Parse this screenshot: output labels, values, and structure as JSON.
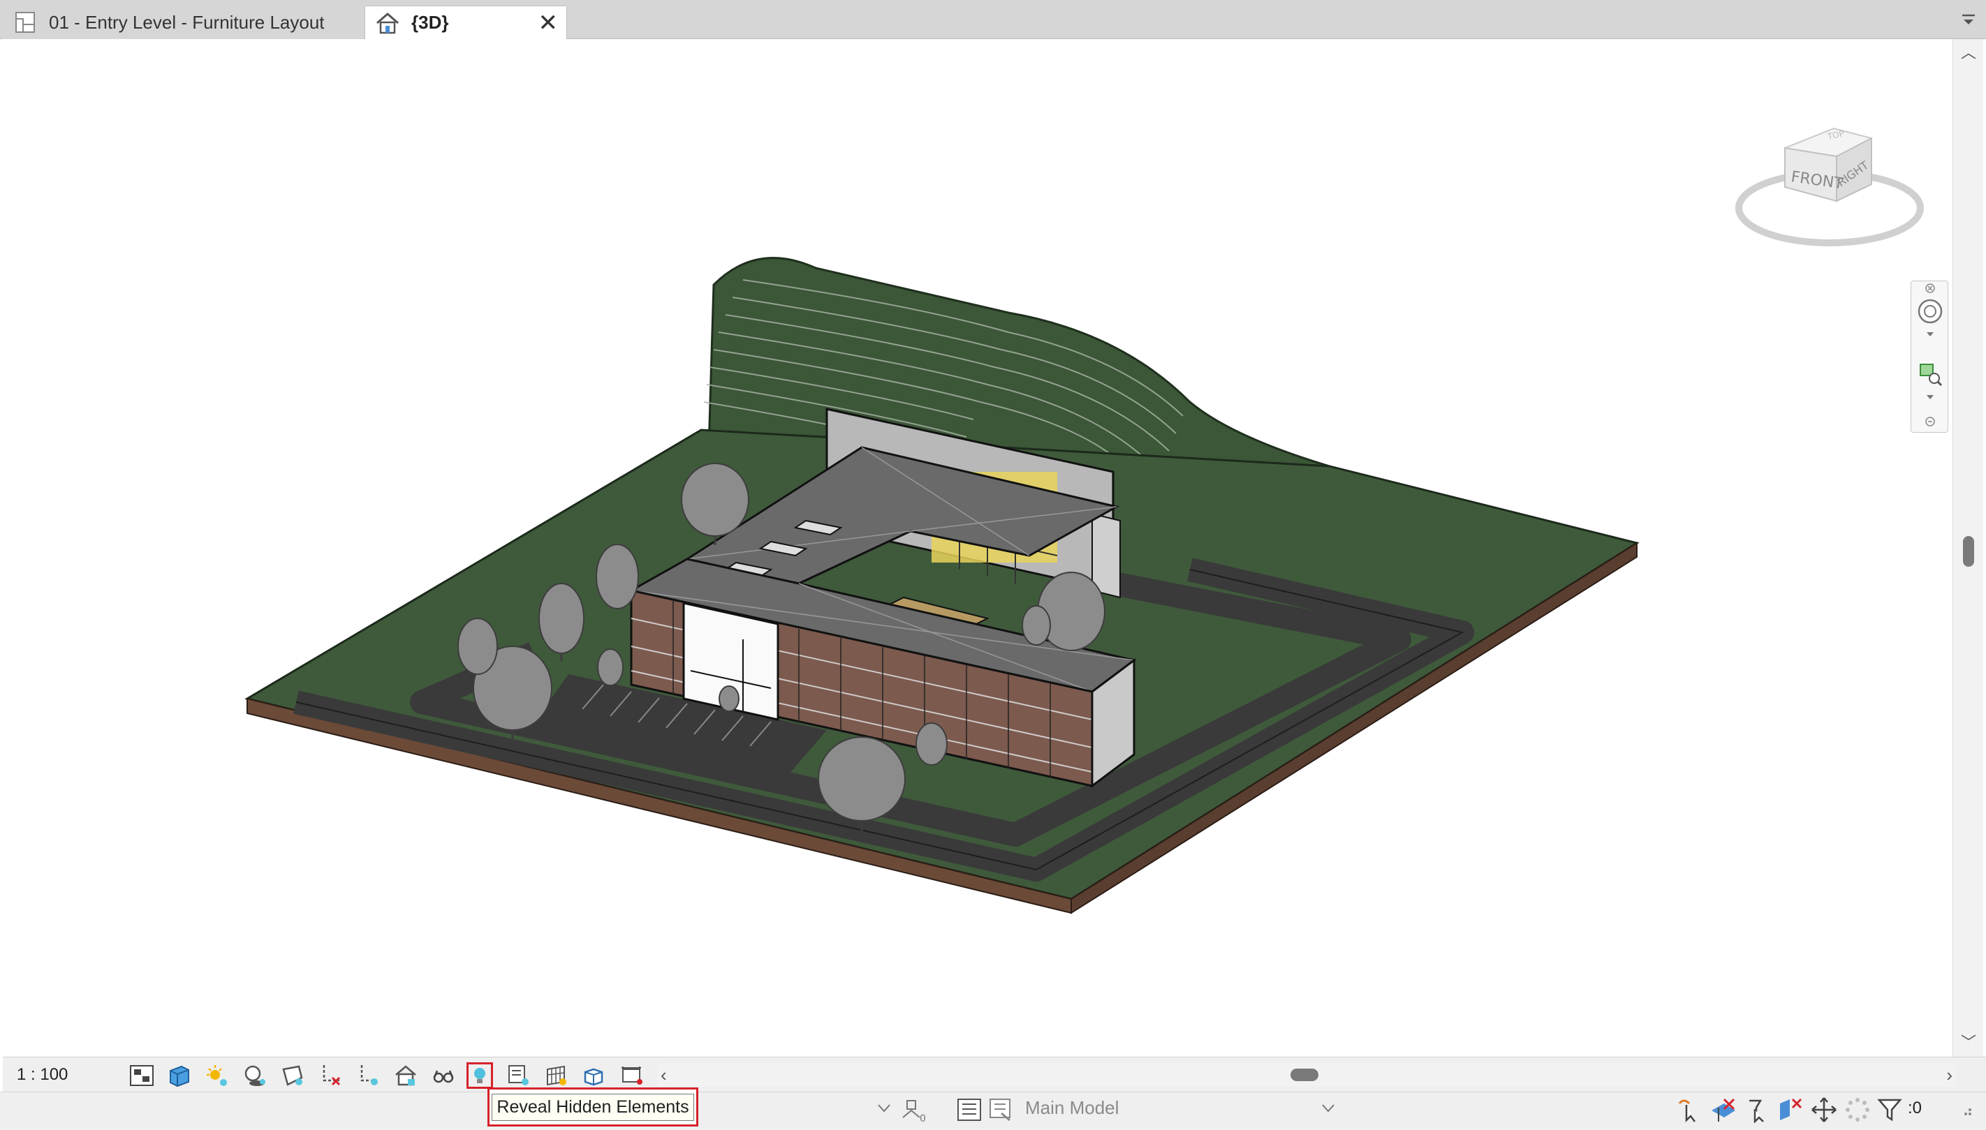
{
  "tabs": [
    {
      "label": "01 - Entry Level - Furniture Layout",
      "active": false
    },
    {
      "label": "{3D}",
      "active": true
    }
  ],
  "tab_close_symbol": "✕",
  "viewcube": {
    "top_label": "TOP",
    "front_label": "FRONT",
    "right_label": "RIGHT"
  },
  "view_control_bar": {
    "scale": "1 : 100",
    "icons": [
      "detail-level-icon",
      "visual-style-icon",
      "sun-path-icon",
      "shadows-icon",
      "rendering-icon",
      "crop-view-icon",
      "show-crop-region-icon",
      "unlock-3d-view-icon",
      "temporary-isolate-icon",
      "reveal-hidden-elements-icon",
      "temporary-view-properties-icon",
      "show-analytical-model-icon",
      "highlight-displacement-icon",
      "reveal-constraints-icon"
    ]
  },
  "tooltip": {
    "text": "Reveal Hidden Elements"
  },
  "status_bar": {
    "design_option": "Main Model",
    "filter_count": ":0"
  },
  "colors": {
    "terrain": "#3f5a3b",
    "terrain_dark": "#2f4a2e",
    "earth_edge": "#6b4a38",
    "road": "#3a3a3a",
    "roof": "#666666",
    "highlight": "#d6222a"
  }
}
